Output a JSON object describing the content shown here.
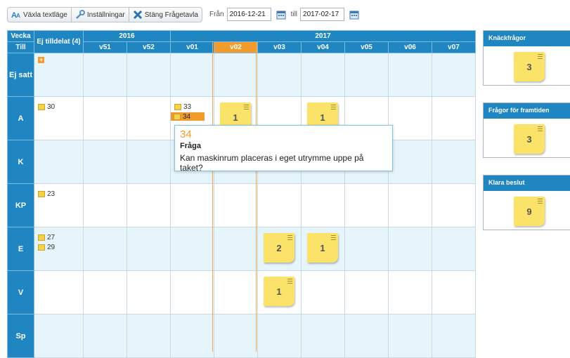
{
  "toolbar": {
    "toggle_text_mode": "Växla textläge",
    "settings": "Inställningar",
    "close_board": "Stäng Frågetavla"
  },
  "date_range": {
    "from_label": "Från",
    "from_value": "2016-12-21",
    "to_label": "till",
    "to_value": "2017-02-17"
  },
  "grid": {
    "corner_top": "Vecka",
    "corner_bottom": "Till",
    "unassigned_header": "Ej tilldelat (4)",
    "years": [
      "2016",
      "2017"
    ],
    "weeks": [
      "v51",
      "v52",
      "v01",
      "v02",
      "v03",
      "v04",
      "v05",
      "v06",
      "v07"
    ],
    "current_week": "v02",
    "rows": [
      "Ej satt",
      "A",
      "K",
      "KP",
      "E",
      "V",
      "Sp"
    ],
    "items": {
      "a_unassigned": "30",
      "a_v01_1": "33",
      "a_v01_2": "34",
      "kp_unassigned": "23",
      "e_unassigned_1": "27",
      "e_unassigned_2": "29"
    },
    "notes": {
      "a_v02": "1",
      "a_v04": "1",
      "e_v03": "2",
      "e_v04": "1",
      "v_v03": "1"
    }
  },
  "sidebar": {
    "knackfragor": {
      "title": "Knäckfrågor",
      "count": "3"
    },
    "framtiden": {
      "title": "Frågor för framtiden",
      "count": "3"
    },
    "klara": {
      "title": "Klara beslut",
      "count": "9"
    }
  },
  "popup": {
    "number": "34",
    "label": "Fråga",
    "text": "Kan maskinrum placeras i eget utrymme uppe på taket?"
  },
  "colors": {
    "header_blue": "#1f86c1",
    "current_week_orange": "#f39a2c",
    "note_yellow": "#fbe36a",
    "row_alt": "#e6f4fb"
  }
}
